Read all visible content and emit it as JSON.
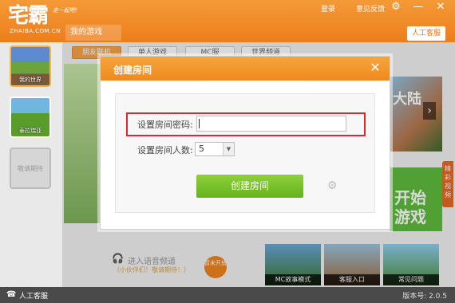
{
  "header": {
    "logo": "宅霸",
    "logo_sub": "ZHAIBA.COM.CN",
    "slogan": "走一起吧!",
    "login": "登录",
    "feedback": "意见反馈",
    "tab_mygames": "我的游戏",
    "support": "人工客服"
  },
  "window_controls": {
    "settings_icon": "⚙",
    "minimize_icon": "—",
    "close_icon": "✕"
  },
  "sidebar": {
    "games": [
      {
        "label": "我的世界"
      },
      {
        "label": "泰拉瑞亚"
      },
      {
        "label": "敬请期待"
      }
    ]
  },
  "subtabs": [
    "朋友联机",
    "单人游戏",
    "MC服",
    "世界频道"
  ],
  "background": {
    "banner_text": "大陆",
    "banner_arrow": "›",
    "start_line1": "开始",
    "start_line2": "游戏",
    "side_promo": "精彩视频"
  },
  "voice": {
    "title": "进入语音频道",
    "subtitle": "（小伙伴们！敬请期待！）",
    "badge": "暂未开放"
  },
  "tiles": [
    {
      "label": "MC故事模式"
    },
    {
      "label": "客服入口"
    },
    {
      "label": "常见问题"
    }
  ],
  "status": {
    "support": "人工客服",
    "version": "版本号: 2.0.5"
  },
  "dialog": {
    "title": "创建房间",
    "close": "✕",
    "password_label": "设置房间密码:",
    "password_value": "",
    "count_label": "设置房间人数:",
    "count_value": "5",
    "count_arrow": "▼",
    "create_button": "创建房间",
    "settings_icon": "⚙"
  },
  "colors": {
    "brand_orange": "#ee7d1b",
    "create_green": "#64b31e",
    "highlight_red": "#e0262e"
  }
}
